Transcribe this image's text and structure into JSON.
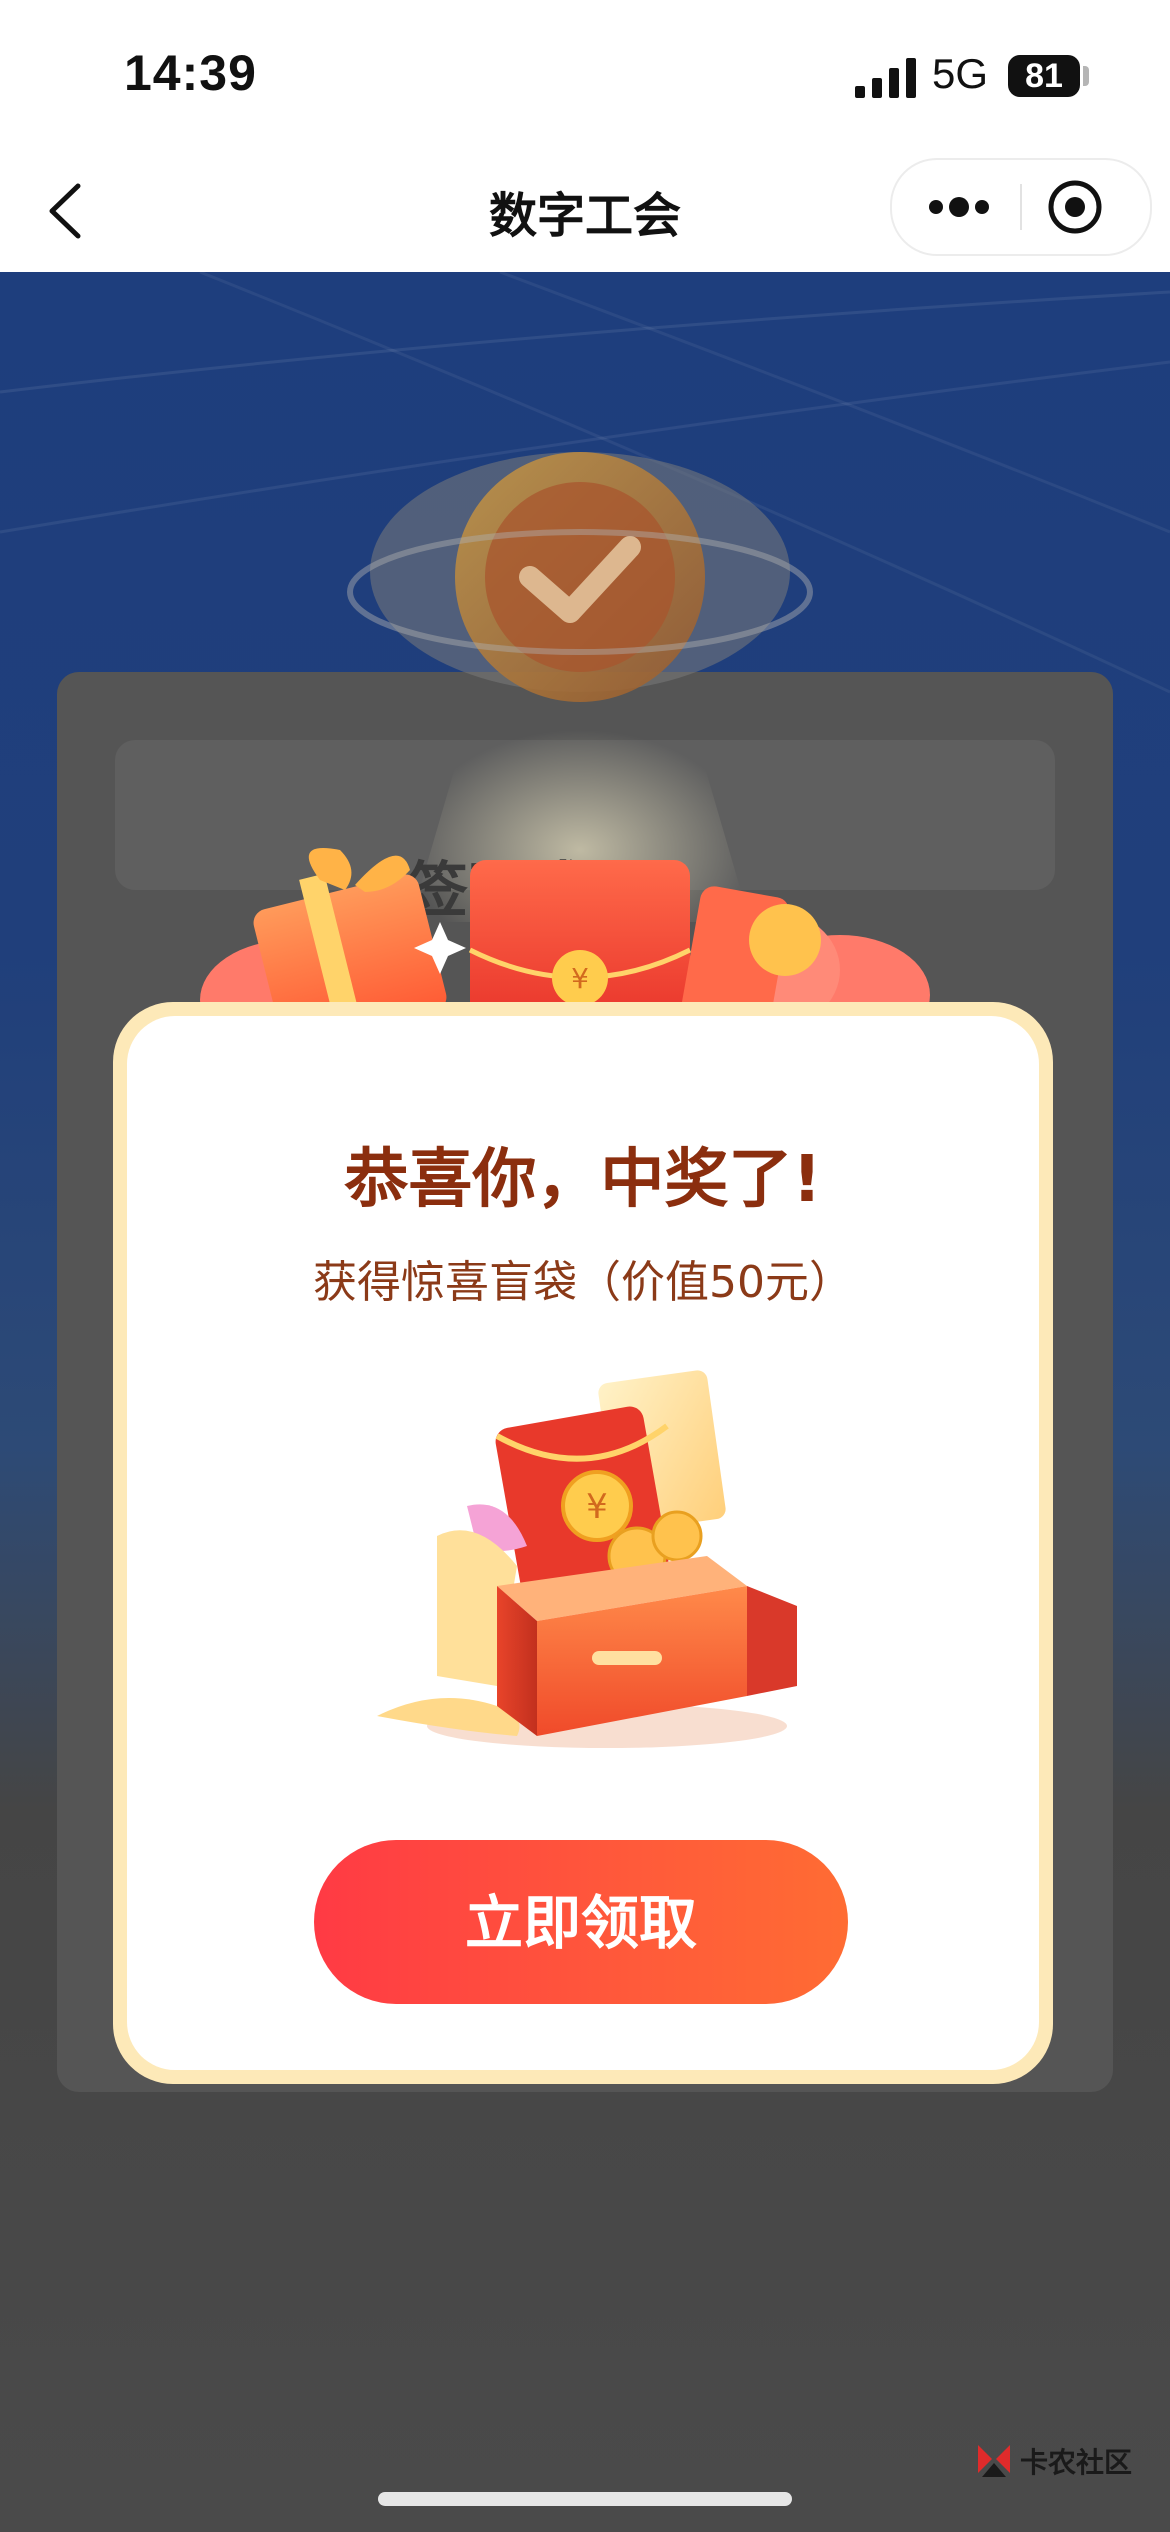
{
  "status_bar": {
    "time": "14:39",
    "network": "5G",
    "battery": "81"
  },
  "nav": {
    "title": "数字工会",
    "back_icon": "chevron-left-icon",
    "more_icon": "more-dots-icon",
    "close_icon": "target-close-icon"
  },
  "background": {
    "obscured_title": "签到成功"
  },
  "popup": {
    "title": "恭喜你，中奖了!",
    "subtitle": "获得惊喜盲袋（价值50元）",
    "claim_label": "立即领取"
  },
  "watermark": {
    "text": "卡农社区"
  },
  "colors": {
    "accent": "#ff4040",
    "title": "#8b2e0e",
    "popup_border": "#fde9b8",
    "background_top": "#1e3e7d"
  }
}
